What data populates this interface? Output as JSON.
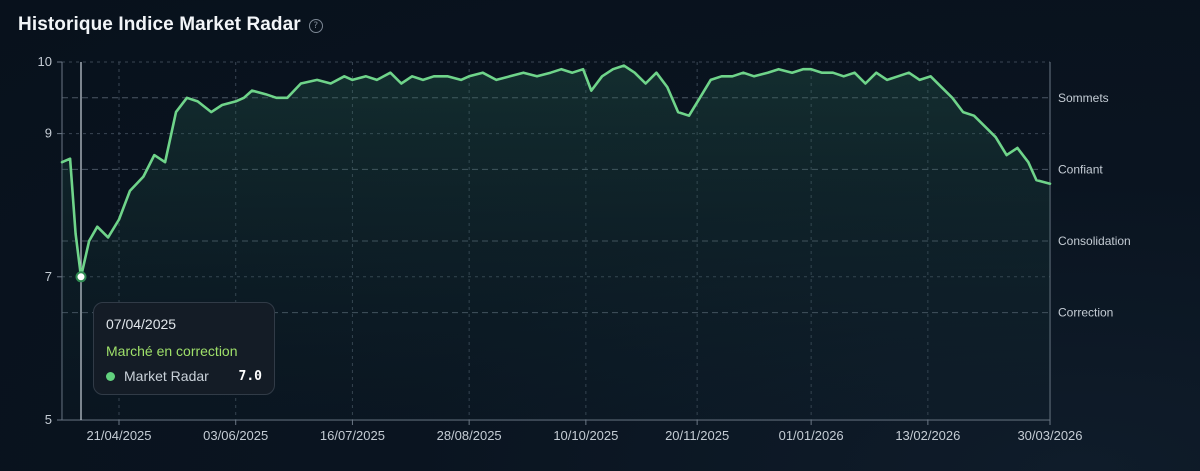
{
  "header": {
    "title": "Historique Indice Market Radar",
    "help_icon": "question-circle-icon"
  },
  "tooltip": {
    "date": "07/04/2025",
    "status": "Marché en correction",
    "series_label": "Market Radar",
    "value": "7.0"
  },
  "colors": {
    "line": "#6fd48a",
    "status": "#9fe06a",
    "grid": "#3a4654",
    "background": "#08111c"
  },
  "chart_data": {
    "type": "line",
    "title": "Historique Indice Market Radar",
    "xlabel": "",
    "ylabel": "",
    "x_range": [
      "2025-03-31",
      "2026-03-30"
    ],
    "ylim": [
      5,
      10
    ],
    "y_ticks": [
      5,
      7,
      9,
      10
    ],
    "x_tick_labels": [
      "21/04/2025",
      "03/06/2025",
      "16/07/2025",
      "28/08/2025",
      "10/10/2025",
      "20/11/2025",
      "01/01/2026",
      "13/02/2026",
      "30/03/2026"
    ],
    "x_ticks": [
      "2025-04-21",
      "2025-06-03",
      "2025-07-16",
      "2025-08-28",
      "2025-10-10",
      "2025-11-20",
      "2026-01-01",
      "2026-02-13",
      "2026-03-30"
    ],
    "zones": [
      {
        "label": "Sommets",
        "y": 9.5
      },
      {
        "label": "Confiant",
        "y": 8.5
      },
      {
        "label": "Consolidation",
        "y": 7.5
      },
      {
        "label": "Correction",
        "y": 6.5
      }
    ],
    "grid": true,
    "highlight": {
      "date": "2025-04-07",
      "value": 7.0
    },
    "series": [
      {
        "points": [
          [
            "2025-03-31",
            8.6
          ],
          [
            "2025-04-03",
            8.65
          ],
          [
            "2025-04-05",
            7.6
          ],
          [
            "2025-04-07",
            7.0
          ],
          [
            "2025-04-10",
            7.5
          ],
          [
            "2025-04-13",
            7.7
          ],
          [
            "2025-04-17",
            7.55
          ],
          [
            "2025-04-21",
            7.8
          ],
          [
            "2025-04-25",
            8.2
          ],
          [
            "2025-04-30",
            8.4
          ],
          [
            "2025-05-04",
            8.7
          ],
          [
            "2025-05-08",
            8.6
          ],
          [
            "2025-05-12",
            9.3
          ],
          [
            "2025-05-16",
            9.5
          ],
          [
            "2025-05-20",
            9.45
          ],
          [
            "2025-05-25",
            9.3
          ],
          [
            "2025-05-29",
            9.4
          ],
          [
            "2025-06-03",
            9.45
          ],
          [
            "2025-06-06",
            9.5
          ],
          [
            "2025-06-09",
            9.6
          ],
          [
            "2025-06-14",
            9.55
          ],
          [
            "2025-06-18",
            9.5
          ],
          [
            "2025-06-22",
            9.5
          ],
          [
            "2025-06-27",
            9.7
          ],
          [
            "2025-07-03",
            9.75
          ],
          [
            "2025-07-08",
            9.7
          ],
          [
            "2025-07-13",
            9.8
          ],
          [
            "2025-07-16",
            9.75
          ],
          [
            "2025-07-21",
            9.8
          ],
          [
            "2025-07-25",
            9.75
          ],
          [
            "2025-07-30",
            9.85
          ],
          [
            "2025-08-03",
            9.7
          ],
          [
            "2025-08-07",
            9.8
          ],
          [
            "2025-08-11",
            9.75
          ],
          [
            "2025-08-15",
            9.8
          ],
          [
            "2025-08-20",
            9.8
          ],
          [
            "2025-08-25",
            9.75
          ],
          [
            "2025-08-28",
            9.8
          ],
          [
            "2025-09-02",
            9.85
          ],
          [
            "2025-09-07",
            9.75
          ],
          [
            "2025-09-12",
            9.8
          ],
          [
            "2025-09-17",
            9.85
          ],
          [
            "2025-09-22",
            9.8
          ],
          [
            "2025-09-27",
            9.85
          ],
          [
            "2025-10-01",
            9.9
          ],
          [
            "2025-10-05",
            9.85
          ],
          [
            "2025-10-09",
            9.9
          ],
          [
            "2025-10-12",
            9.6
          ],
          [
            "2025-10-16",
            9.8
          ],
          [
            "2025-10-20",
            9.9
          ],
          [
            "2025-10-24",
            9.95
          ],
          [
            "2025-10-28",
            9.85
          ],
          [
            "2025-11-01",
            9.7
          ],
          [
            "2025-11-05",
            9.85
          ],
          [
            "2025-11-09",
            9.65
          ],
          [
            "2025-11-13",
            9.3
          ],
          [
            "2025-11-17",
            9.25
          ],
          [
            "2025-11-21",
            9.5
          ],
          [
            "2025-11-25",
            9.75
          ],
          [
            "2025-11-29",
            9.8
          ],
          [
            "2025-12-03",
            9.8
          ],
          [
            "2025-12-07",
            9.85
          ],
          [
            "2025-12-11",
            9.8
          ],
          [
            "2025-12-16",
            9.85
          ],
          [
            "2025-12-20",
            9.9
          ],
          [
            "2025-12-25",
            9.85
          ],
          [
            "2025-12-29",
            9.9
          ],
          [
            "2026-01-01",
            9.9
          ],
          [
            "2026-01-05",
            9.85
          ],
          [
            "2026-01-09",
            9.85
          ],
          [
            "2026-01-13",
            9.8
          ],
          [
            "2026-01-17",
            9.85
          ],
          [
            "2026-01-21",
            9.7
          ],
          [
            "2026-01-25",
            9.85
          ],
          [
            "2026-01-29",
            9.75
          ],
          [
            "2026-02-02",
            9.8
          ],
          [
            "2026-02-06",
            9.85
          ],
          [
            "2026-02-10",
            9.75
          ],
          [
            "2026-02-14",
            9.8
          ],
          [
            "2026-02-18",
            9.65
          ],
          [
            "2026-02-22",
            9.5
          ],
          [
            "2026-02-26",
            9.3
          ],
          [
            "2026-03-02",
            9.25
          ],
          [
            "2026-03-06",
            9.1
          ],
          [
            "2026-03-10",
            8.95
          ],
          [
            "2026-03-14",
            8.7
          ],
          [
            "2026-03-18",
            8.8
          ],
          [
            "2026-03-22",
            8.6
          ],
          [
            "2026-03-25",
            8.35
          ],
          [
            "2026-03-30",
            8.3
          ]
        ]
      }
    ]
  }
}
